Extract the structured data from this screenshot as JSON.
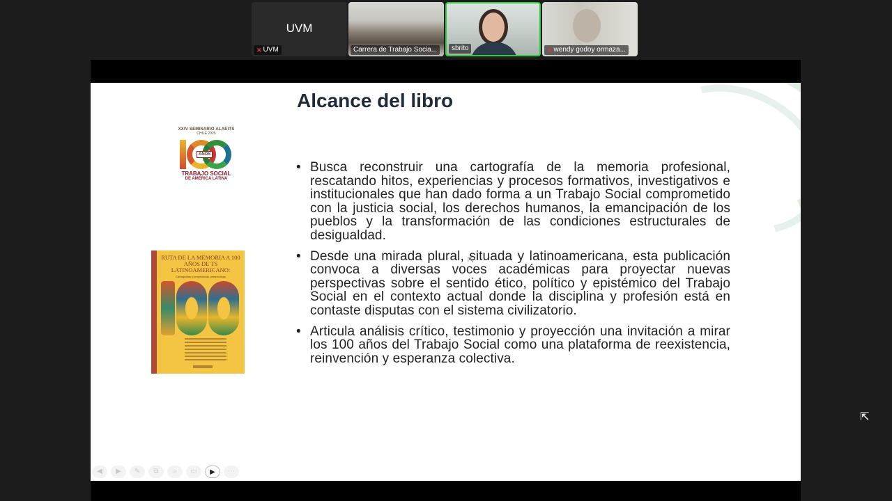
{
  "participants": [
    {
      "name": "UVM",
      "big_label": "UVM",
      "muted": true
    },
    {
      "name": "Carrera de Trabajo Socia...",
      "muted": false
    },
    {
      "name": "sbrito",
      "muted": false,
      "active_speaker": true
    },
    {
      "name": "wendy godoy ormaza...",
      "muted": true
    }
  ],
  "slide": {
    "title": "Alcance del libro",
    "logo": {
      "seminar": "XXIV SEMINARIO ALAEITS",
      "year": "CHILE 2025",
      "anos": "AÑOS",
      "line1": "TRABAJO SOCIAL",
      "line2": "DE AMÉRICA LATINA"
    },
    "book": {
      "title": "RUTA DE LA MEMORIA A 100 AÑOS DE TS LATINOAMERICANO:",
      "subtitle": "Cartografías y proyectando perspectivas"
    },
    "bullets": [
      "Busca reconstruir una cartografía de la memoria profesional, rescatando hitos, experiencias y procesos formativos, investigativos e institucionales que han dado forma a un Trabajo Social comprometido con la justicia social, los derechos humanos, la emancipación de los pueblos y la transformación de las condiciones estructurales de desigualdad.",
      "Desde una mirada plural, situada y latinoamericana, esta publicación convoca a diversas voces académicas para proyectar nuevas perspectivas sobre el sentido ético, político y epistémico del Trabajo Social en el contexto actual donde la disciplina y profesión está en contaste disputas con el sistema civilizatorio.",
      "Articula análisis crítico, testimonio y proyección una invitación a mirar los 100 años del Trabajo Social como una plataforma de reexistencia, reinvención y esperanza colectiva."
    ]
  },
  "toolbar_icons": [
    "prev-icon",
    "next-icon",
    "pen-icon",
    "copy-icon",
    "zoom-icon",
    "subtitle-icon",
    "camera-icon",
    "more-icon"
  ],
  "colors": {
    "active_speaker": "#2ecc40",
    "muted": "#e53935",
    "book_cover": "#f3c543",
    "title": "#1f2a3a"
  }
}
